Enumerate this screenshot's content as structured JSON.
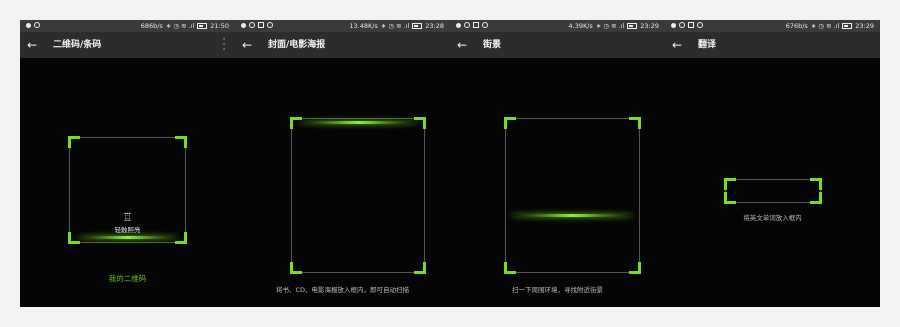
{
  "accent_color": "#7bdc1f",
  "screens": [
    {
      "status": {
        "speed": "686b/s",
        "time": "21:50"
      },
      "title": "二维码/条码",
      "flashlight_label": "轻触照亮",
      "my_qr_label": "我的二维码",
      "icons": {
        "back": "arrow-back-icon",
        "more": "more-vert-icon",
        "flashlight": "flashlight-icon"
      }
    },
    {
      "status": {
        "speed": "13.48K/s",
        "time": "23:28"
      },
      "title": "封面/电影海报",
      "hint": "将书、CD、电影海报放入框内，即可自动扫描"
    },
    {
      "status": {
        "speed": "4.39K/s",
        "time": "23:29"
      },
      "title": "街景",
      "hint": "扫一下周围环境，寻找附近街景"
    },
    {
      "status": {
        "speed": "676b/s",
        "time": "23:29"
      },
      "title": "翻译",
      "hint": "将英文单词放入框内"
    }
  ]
}
